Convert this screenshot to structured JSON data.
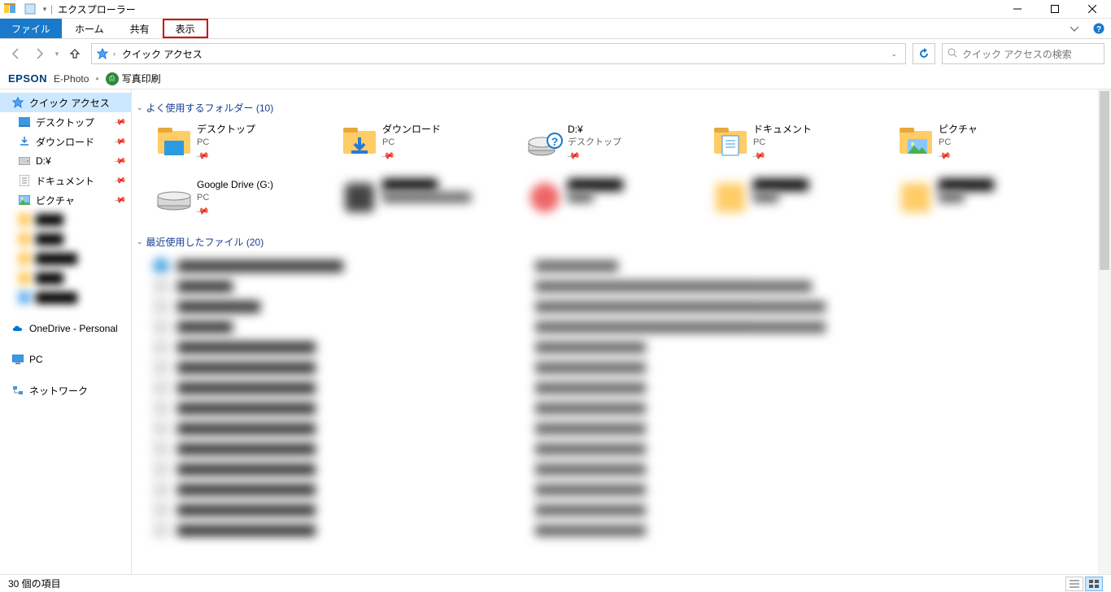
{
  "window": {
    "title": "エクスプローラー",
    "min": "—",
    "max": "▢",
    "close": "✕"
  },
  "ribbon": {
    "file": "ファイル",
    "home": "ホーム",
    "share": "共有",
    "view": "表示"
  },
  "nav": {
    "location": "クイック アクセス",
    "search_placeholder": "クイック アクセスの検索"
  },
  "epson": {
    "logo": "EPSON",
    "product": "E-Photo",
    "print": "写真印刷"
  },
  "sidebar": {
    "quick_access": "クイック アクセス",
    "items": [
      {
        "label": "デスクトップ",
        "icon": "desktop"
      },
      {
        "label": "ダウンロード",
        "icon": "download"
      },
      {
        "label": "D:¥",
        "icon": "drive"
      },
      {
        "label": "ドキュメント",
        "icon": "document"
      },
      {
        "label": "ピクチャ",
        "icon": "pictures"
      }
    ],
    "onedrive": "OneDrive - Personal",
    "pc": "PC",
    "network": "ネットワーク"
  },
  "groups": {
    "frequent": "よく使用するフォルダー (10)",
    "recent": "最近使用したファイル (20)"
  },
  "folders": [
    {
      "name": "デスクトップ",
      "loc": "PC",
      "icon": "desktop-l"
    },
    {
      "name": "ダウンロード",
      "loc": "PC",
      "icon": "download-l"
    },
    {
      "name": "D:¥",
      "loc": "デスクトップ",
      "icon": "unknown-drive"
    },
    {
      "name": "ドキュメント",
      "loc": "PC",
      "icon": "document-l"
    },
    {
      "name": "ピクチャ",
      "loc": "PC",
      "icon": "pictures-l"
    },
    {
      "name": "Google Drive (G:)",
      "loc": "PC",
      "icon": "drive-l"
    }
  ],
  "status": {
    "count": "30 個の項目"
  }
}
